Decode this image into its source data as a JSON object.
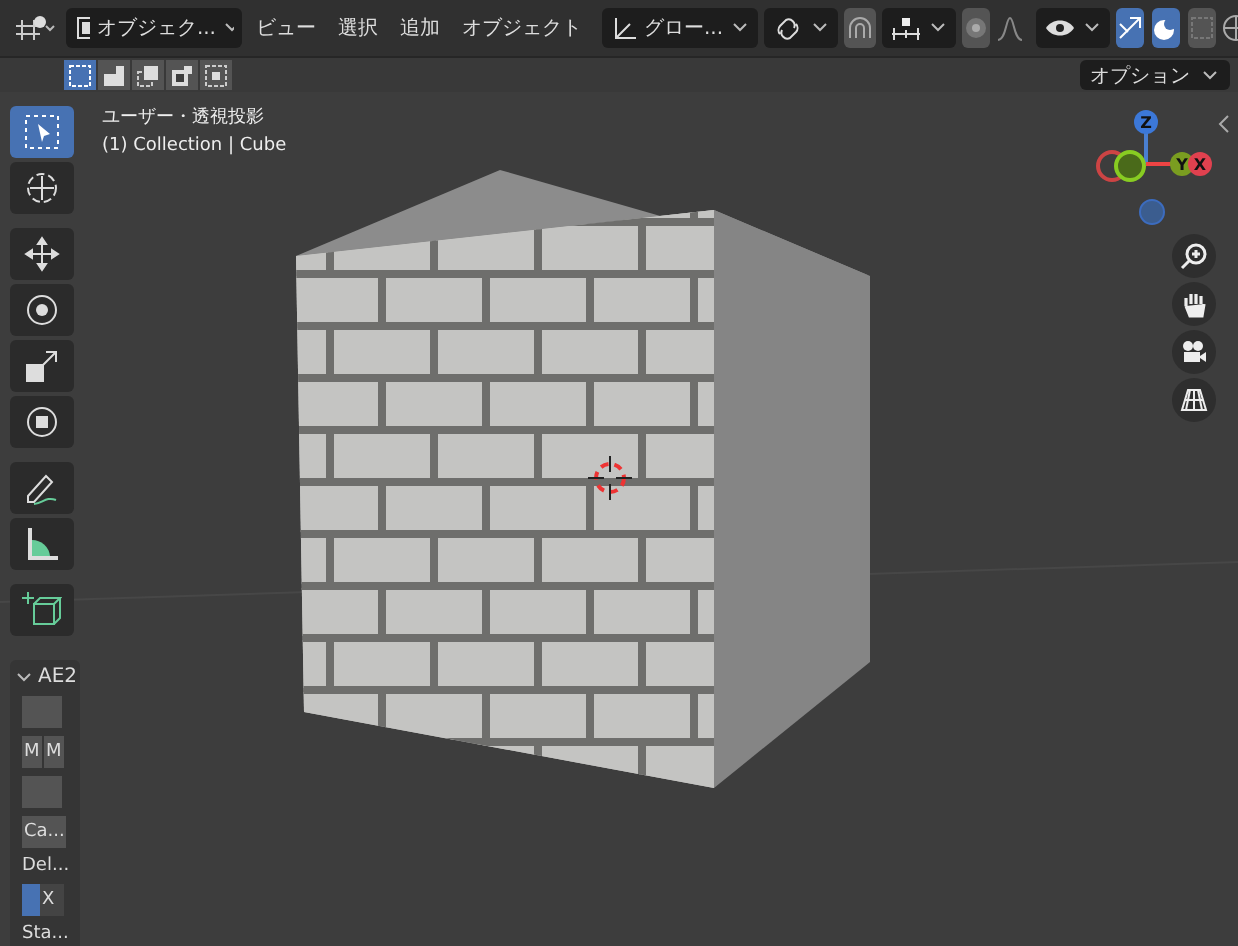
{
  "header": {
    "mode": "オブジェク...",
    "menus": [
      "ビュー",
      "選択",
      "追加",
      "オブジェクト"
    ],
    "orientation": "グロー...",
    "toggles": [
      {
        "kind": "snap",
        "on": false
      },
      {
        "kind": "proportional",
        "on": false
      },
      {
        "kind": "visibility",
        "on": false
      },
      {
        "kind": "gizmo",
        "on": true
      },
      {
        "kind": "overlay",
        "on": true
      },
      {
        "kind": "xray",
        "on": false
      }
    ]
  },
  "select_modes": [
    {
      "selected": true
    },
    {
      "selected": false
    },
    {
      "selected": false
    },
    {
      "selected": false
    },
    {
      "selected": false
    }
  ],
  "options_button": "オプション",
  "viewport": {
    "view_name": "ユーザー・透視投影",
    "object_info": "(1) Collection | Cube"
  },
  "tool_groups": [
    [
      {
        "kind": "select",
        "selected": true
      },
      {
        "kind": "cursor",
        "selected": false
      }
    ],
    [
      {
        "kind": "move",
        "selected": false
      },
      {
        "kind": "rotate",
        "selected": false
      },
      {
        "kind": "scale",
        "selected": false
      },
      {
        "kind": "transform",
        "selected": false
      }
    ],
    [
      {
        "kind": "annotate",
        "selected": false
      },
      {
        "kind": "measure",
        "selected": false
      }
    ],
    [
      {
        "kind": "add_cube",
        "selected": false
      }
    ]
  ],
  "gizmo_axes": [
    {
      "label": "Z"
    },
    {
      "label": "Y"
    },
    {
      "label": "X"
    }
  ],
  "panel": {
    "title": "AE2",
    "expanded": true,
    "items": [
      {
        "kind": "swatch"
      },
      {
        "kind": "pair",
        "labels": [
          "M",
          "M"
        ]
      },
      {
        "kind": "swatch"
      },
      {
        "kind": "button",
        "label": "Ca..."
      },
      {
        "kind": "text",
        "label": "Del..."
      },
      {
        "kind": "toggle",
        "checked": true,
        "label": "X"
      },
      {
        "kind": "text",
        "label": "Sta..."
      }
    ]
  }
}
